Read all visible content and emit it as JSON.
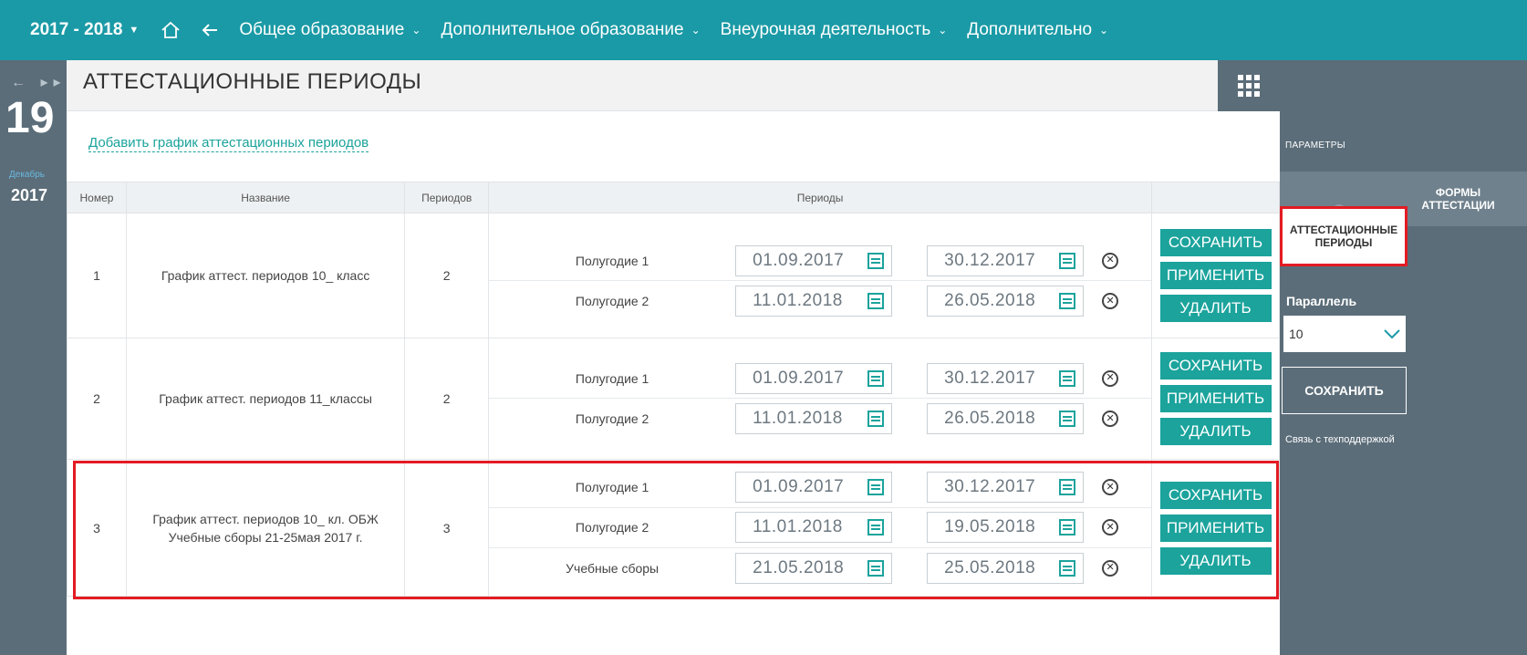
{
  "topnav": {
    "year": "2017 - 2018",
    "items": [
      {
        "label": "Общее образование"
      },
      {
        "label": "Дополнительное образование"
      },
      {
        "label": "Внеурочная деятельность"
      },
      {
        "label": "Дополнительно"
      }
    ]
  },
  "calendar": {
    "day": "19",
    "month": "Декабрь",
    "year": "2017"
  },
  "page": {
    "title": "АТТЕСТАЦИОННЫЕ ПЕРИОДЫ",
    "add_link": "Добавить график аттестационных периодов"
  },
  "table": {
    "headers": {
      "number": "Номер",
      "name": "Название",
      "count": "Периодов",
      "periods": "Периоды"
    },
    "rows": [
      {
        "number": "1",
        "name_line1": "График аттест. периодов 10_ класс",
        "name_line2": "",
        "count": "2",
        "periods": [
          {
            "name": "Полугодие 1",
            "start": "01.09.2017",
            "end": "30.12.2017"
          },
          {
            "name": "Полугодие 2",
            "start": "11.01.2018",
            "end": "26.05.2018"
          }
        ]
      },
      {
        "number": "2",
        "name_line1": "График аттест. периодов 11_классы",
        "name_line2": "",
        "count": "2",
        "periods": [
          {
            "name": "Полугодие 1",
            "start": "01.09.2017",
            "end": "30.12.2017"
          },
          {
            "name": "Полугодие 2",
            "start": "11.01.2018",
            "end": "26.05.2018"
          }
        ]
      },
      {
        "number": "3",
        "name_line1": "График аттест. периодов 10_ кл. ОБЖ",
        "name_line2": "Учебные сборы 21-25мая 2017 г.",
        "count": "3",
        "periods": [
          {
            "name": "Полугодие 1",
            "start": "01.09.2017",
            "end": "30.12.2017"
          },
          {
            "name": "Полугодие 2",
            "start": "11.01.2018",
            "end": "19.05.2018"
          },
          {
            "name": "Учебные сборы",
            "start": "21.05.2018",
            "end": "25.05.2018"
          }
        ]
      }
    ],
    "buttons": {
      "save": "СОХРАНИТЬ",
      "apply": "ПРИМЕНИТЬ",
      "delete": "УДАЛИТЬ"
    }
  },
  "sidebar": {
    "params_label": "ПАРАМЕТРЫ",
    "forms_line1": "ФОРМЫ",
    "forms_line2": "АТТЕСТАЦИИ",
    "active_line1": "АТТЕСТАЦИОННЫЕ",
    "active_line2": "ПЕРИОДЫ",
    "parallel_label": "Параллель",
    "parallel_value": "10",
    "save_label": "СОХРАНИТЬ",
    "support_label": "Связь с техподдержкой"
  },
  "colors": {
    "topbar": "#1a9aa6",
    "sidebar": "#5b6d79",
    "accent": "#1ba39c",
    "highlight": "#e31b23"
  }
}
